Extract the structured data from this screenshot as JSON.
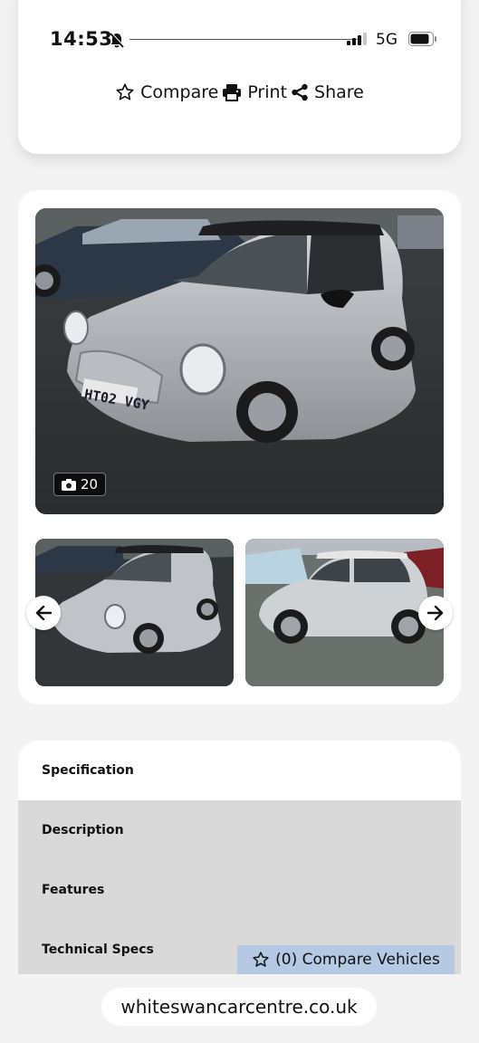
{
  "status": {
    "time": "14:53",
    "network": "5G"
  },
  "actions": [
    {
      "label": "Compare",
      "icon": "star-outline-icon"
    },
    {
      "label": "Print",
      "icon": "printer-icon"
    },
    {
      "label": "Share",
      "icon": "share-icon"
    }
  ],
  "gallery": {
    "photo_count": "20",
    "plate": "HT02 VGY"
  },
  "tabs": [
    {
      "label": "Specification"
    },
    {
      "label": "Description"
    },
    {
      "label": "Features"
    },
    {
      "label": "Technical Specs"
    }
  ],
  "compare_bar": {
    "label": "(0) Compare Vehicles"
  },
  "browser": {
    "url": "whiteswancarcentre.co.uk"
  },
  "colors": {
    "accent_bar": "#b5c8e4",
    "tab_inactive": "#d9d9d9",
    "background": "#f3f3f3"
  }
}
